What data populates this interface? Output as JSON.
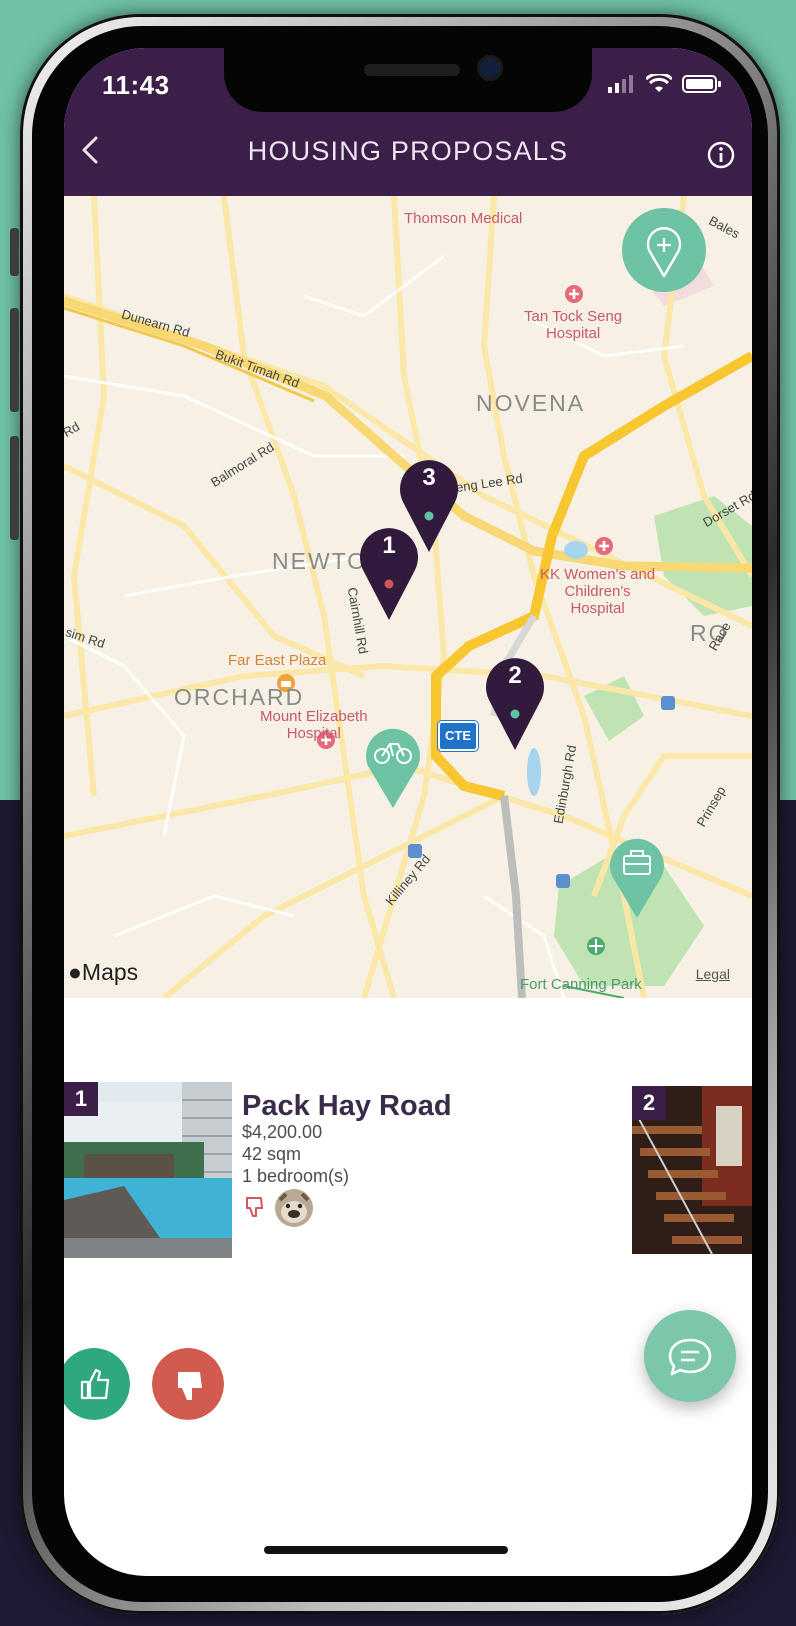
{
  "status_bar": {
    "time": "11:43"
  },
  "header": {
    "title": "HOUSING PROPOSALS"
  },
  "map": {
    "districts": [
      "NOVENA",
      "NEWTON",
      "ORCHARD",
      "RO"
    ],
    "places": {
      "thomson": "Thomson Medical",
      "tan_tock_seng": "Tan Tock Seng\nHospital",
      "kk": "KK Women's and\nChildren's\nHospital",
      "far_east": "Far East Plaza",
      "mount_elizabeth": "Mount Elizabeth\nHospital",
      "fort_canning": "Fort Canning Park"
    },
    "roads": {
      "dunearn": "Dunearn Rd",
      "bukit_timah": "Bukit Timah Rd",
      "balmoral": "Balmoral Rd",
      "cairnhill": "Cairnhill Rd",
      "seng_lee": "eng Lee Rd",
      "killiney": "Killiney Rd",
      "edinburgh": "Edinburgh Rd",
      "dorset": "Dorset Rd",
      "race": "Race",
      "princep": "Prinsep",
      "sim": "sim Rd",
      "bales": "Bales",
      "rd": "Rd"
    },
    "highway_badge": "CTE",
    "pins": [
      {
        "label": "1",
        "dot_color": "#d0575a"
      },
      {
        "label": "3",
        "dot_color": "#5ec3a4"
      },
      {
        "label": "2",
        "dot_color": "#5ec3a4"
      }
    ],
    "brand": "Maps",
    "legal": "Legal",
    "accent_color": "#6fc3a5",
    "pin_color": "#311a3c"
  },
  "proposals": [
    {
      "number": "1",
      "title": "Pack Hay Road",
      "price": "$4,200.00",
      "area": "42 sqm",
      "bedrooms": "1 bedroom(s)"
    },
    {
      "number": "2"
    }
  ],
  "colors": {
    "header": "#3b1f48",
    "like": "#2fa77f",
    "dislike": "#d15b4e",
    "chat": "#7cc7aa"
  }
}
